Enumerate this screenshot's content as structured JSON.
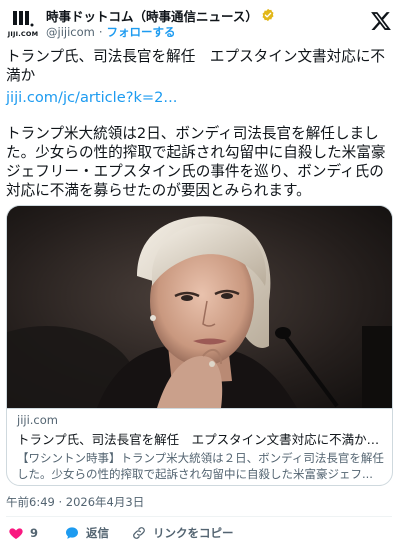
{
  "account": {
    "display_name": "時事ドットコム（時事通信ニュース）",
    "handle": "@jijicom",
    "separator": "·",
    "follow_label": "フォローする",
    "logo_text": "JIJI.COM"
  },
  "tweet": {
    "title": "トランプ氏、司法長官を解任　エプスタイン文書対応に不満か",
    "link": "jiji.com/jc/article?k=2...",
    "body": "トランプ米大統領は2日、ボンディ司法長官を解任しました。少女らの性的搾取で起訴され勾留中に自殺した米富豪ジェフリー・エプスタイン氏の事件を巡り、ボンディ氏の対応に不満を募らせたのが要因とみられます。"
  },
  "link_card": {
    "domain": "jiji.com",
    "title": "トランプ氏、司法長官を解任　エプスタイン文書対応に不満か—米：...",
    "description": "【ワシントン時事】トランプ米大統領は２日、ボンディ司法長官を解任した。少女らの性的搾取で起訴され勾留中に自殺した米富豪ジェフ..."
  },
  "timestamp": "午前6:49 · 2026年4月3日",
  "actions": {
    "like_count": "9",
    "reply_label": "返信",
    "copy_link_label": "リンクをコピー"
  },
  "colors": {
    "accent": "#1d9bf0",
    "like": "#f91880",
    "verified": "#e2b719",
    "text_secondary": "#536471"
  }
}
